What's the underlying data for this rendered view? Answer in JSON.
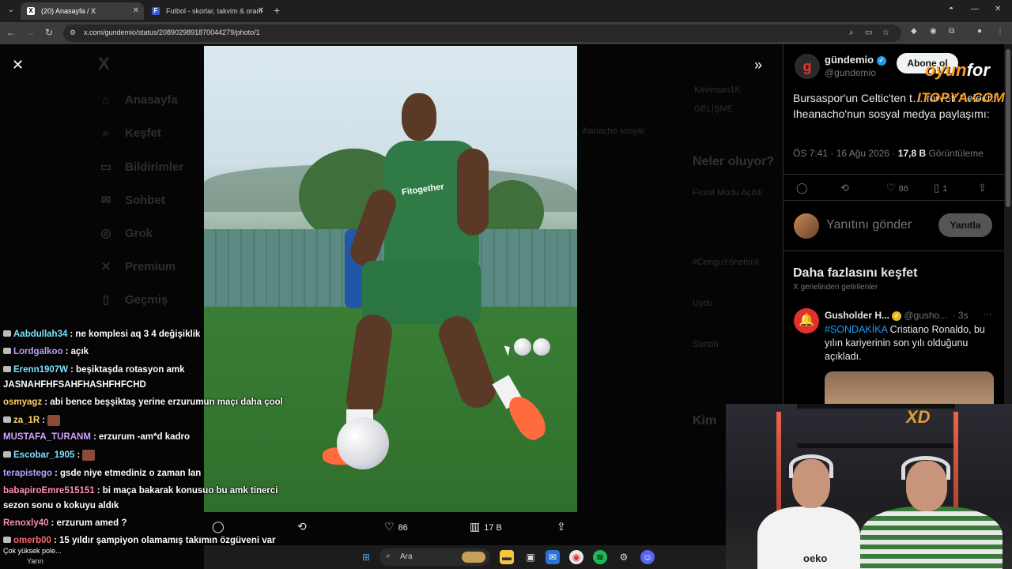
{
  "browser": {
    "tabs": [
      {
        "title": "(20) Anasayfa / X",
        "favicon": "X"
      },
      {
        "title": "Futbol - skorlar, takvim & oranl",
        "favicon": "F"
      }
    ],
    "new_tab": "+",
    "url": "x.com/gundemio/status/2089029891870044279/photo/1"
  },
  "background_nav": {
    "logo": "X",
    "items": [
      "Anasayfa",
      "Keşfet",
      "Bildirimler",
      "Sohbet",
      "Grok",
      "Premium",
      "Geçmiş"
    ],
    "mid_texts": [
      "Neler oluyor?",
      "Fırsat Modu Açıldı",
      "#CenguYönetimli",
      "Uydu",
      "Sürtoh",
      "Kim"
    ],
    "mid_snippets": [
      "Kevinsan1K",
      "GELİŞME",
      "ihanacho sosyal"
    ]
  },
  "media": {
    "sponsor": "Fitogether",
    "bar": {
      "replies": "",
      "retweets": "",
      "likes": "86",
      "views": "17 B",
      "share": ""
    }
  },
  "tweet": {
    "name": "gündemio",
    "handle": "@gundemio",
    "subscribe": "Abone ol",
    "text": "Bursaspor'un Celtic'ten t… forveti Kelechi Iheanacho'nun sosyal medya paylaşımı:",
    "time": "ÖS 7:41 · 16 Ağu 2026 ·",
    "views_count": "17,8 B",
    "views_label": "Görüntüleme",
    "likes": "86",
    "bookmarks": "1",
    "reply_placeholder": "Yanıtını gönder",
    "reply_button": "Yanıtla"
  },
  "discover": {
    "title": "Daha fazlasını keşfet",
    "subtitle": "X genelinden getirilenler",
    "tweet": {
      "name": "Gusholder H...",
      "handle": "@gusho...",
      "time": "· 3s",
      "hashtag": "#SONDAKİKA",
      "text": " Cristiano Ronaldo, bu yılın kariyerinin son yılı olduğunu açıkladı."
    }
  },
  "chat": [
    {
      "user": "Aabdullah34",
      "color": "#7fe3ff",
      "msg": ": ne komplesi aq 3 4 değişiklik"
    },
    {
      "user": "Lordgalkoo",
      "color": "#b9a0ff",
      "msg": ": açık"
    },
    {
      "user": "Erenn1907W",
      "color": "#7fe3ff",
      "msg": ": beşiktaşda rotasyon amk"
    },
    {
      "user": "",
      "color": "#ffffff",
      "msg": "JASNAHFHFSAHFHASHFHFCHD"
    },
    {
      "user": "osmyagz",
      "color": "#ffd36b",
      "msg": ": abi bence beşşiktaş yerine erzurumun maçı daha çool"
    },
    {
      "user": "za_1R",
      "color": "#ffd36b",
      "msg": ":"
    },
    {
      "user": "MUSTAFA_TURANM",
      "color": "#d5a0ff",
      "msg": ": erzurum -am*d kadro"
    },
    {
      "user": "Escobar_1905",
      "color": "#7fe3ff",
      "msg": ":"
    },
    {
      "user": "terapistego",
      "color": "#b9a0ff",
      "msg": ": gsde niye etmediniz o zaman lan"
    },
    {
      "user": "babapiroEmre515151",
      "color": "#ff8fb1",
      "msg": ": bi maça bakarak konusuo bu amk tinerci"
    },
    {
      "user": "",
      "color": "#ffffff",
      "msg": "sezon sonu o kokuyu aldık"
    },
    {
      "user": "Renoxly40",
      "color": "#ff8fb1",
      "msg": ": erzurum amed ?"
    },
    {
      "user": "omerb00",
      "color": "#ff6b6b",
      "msg": ": 15 yıldır şampiyon olamamış takımın özgüveni var"
    }
  ],
  "low_chat": {
    "line1": "Çok yüksek pole...",
    "line2": "Yarın"
  },
  "watermark": {
    "line1": "oyun",
    "line1b": "for",
    "line2": "ITOPYA.COM"
  },
  "taskbar": {
    "search": "Ara"
  },
  "webcam": {
    "logo": "XD",
    "jersey": "oeko"
  }
}
